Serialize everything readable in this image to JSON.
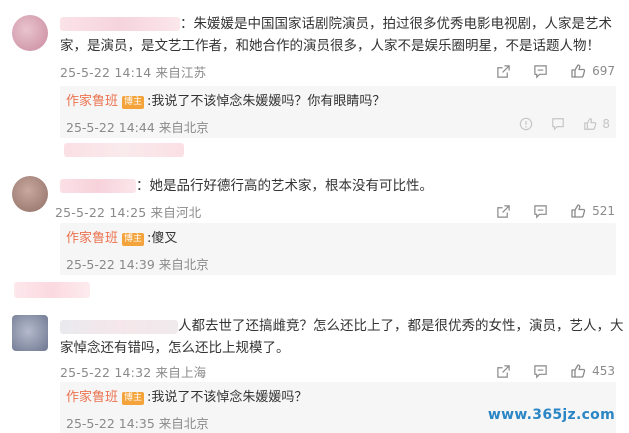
{
  "comments": [
    {
      "text_line1": "：朱媛媛是中国国家话剧院演员，拍过很多优秀电影电视剧，人家是艺术",
      "text_line2": "家，是演员，是文艺工作者，和她合作的演员很多，人家不是娱乐圈明星，不是话题人物！",
      "meta": "25-5-22 14:14 来自江苏",
      "likes": "697",
      "reply": {
        "author": "作家鲁班",
        "badge": "博主",
        "text": ":我说了不该悼念朱媛媛吗？你有眼睛吗？",
        "meta": "25-5-22 14:44 来自北京",
        "likes": "8"
      }
    },
    {
      "text_line1": "：她是品行好德行高的艺术家，根本没有可比性。",
      "meta": "25-5-22 14:25 来自河北",
      "likes": "521",
      "reply": {
        "author": "作家鲁班",
        "badge": "博主",
        "text": ":傻叉",
        "meta": "25-5-22 14:39 来自北京"
      }
    },
    {
      "text_line1": "人都去世了还搞雌竞？怎么还比上了，都是很优秀的女性，演员，艺人，大",
      "text_line2": "家悼念还有错吗，怎么还比上规模了。",
      "meta": "25-5-22 14:32 来自上海",
      "likes": "453",
      "reply": {
        "author": "作家鲁班",
        "badge": "博主",
        "text": ":我说了不该悼念朱媛媛吗？",
        "meta": "25-5-22 14:35 来自北京"
      }
    }
  ],
  "watermark": "www.365jz.com",
  "icons": {
    "share": "share-icon",
    "comment": "comment-icon",
    "like": "thumbs-up-icon",
    "report": "report-icon"
  },
  "colors": {
    "author": "#eb7350",
    "badge": "#f3a33a",
    "meta": "#8a8a8a",
    "reply_bg": "#f6f6f6",
    "watermark": "#2b86c5"
  }
}
